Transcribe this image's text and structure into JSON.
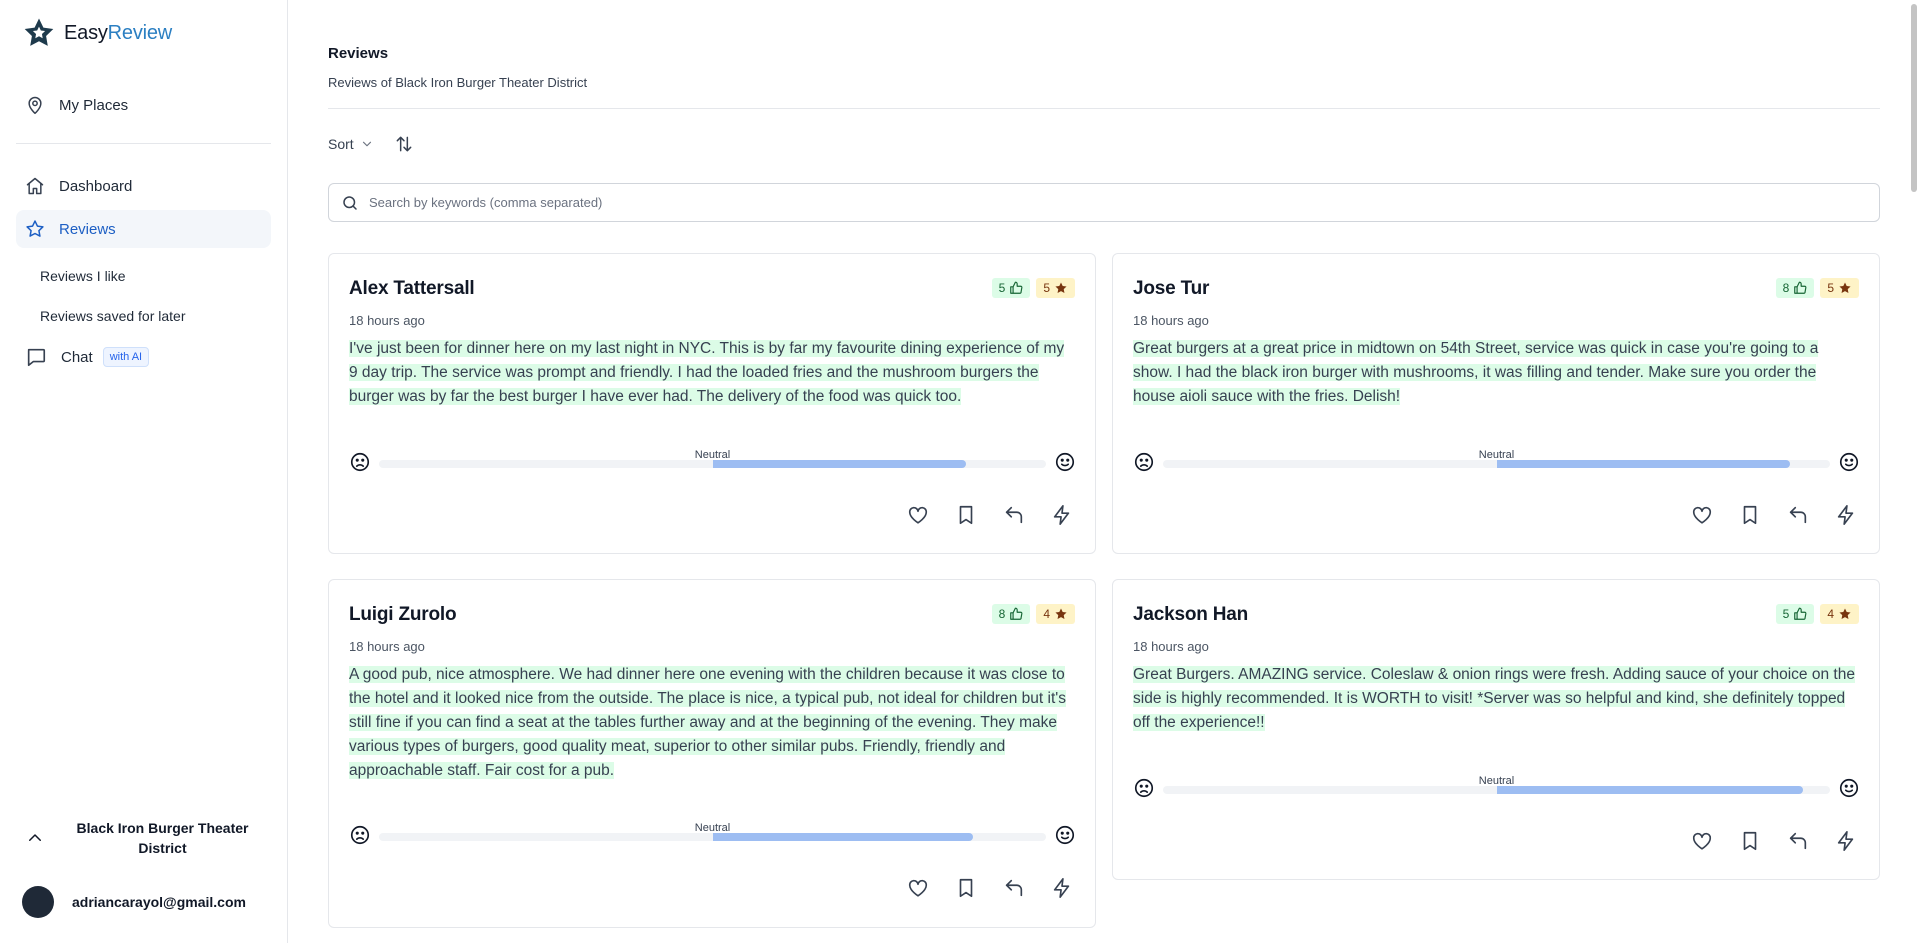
{
  "brand": {
    "part1": "Easy",
    "part2": "Review"
  },
  "sidebar": {
    "my_places": "My Places",
    "dashboard": "Dashboard",
    "reviews": "Reviews",
    "reviews_i_like": "Reviews I like",
    "reviews_saved": "Reviews saved for later",
    "chat": "Chat",
    "chat_badge": "with AI",
    "place_name": "Black Iron Burger Theater District",
    "user_email": "adriancarayol@gmail.com"
  },
  "main": {
    "title": "Reviews",
    "subtitle": "Reviews of Black Iron Burger Theater District",
    "sort_label": "Sort",
    "search_placeholder": "Search by keywords (comma separated)"
  },
  "sentiment_label": "Neutral",
  "colors": {
    "accent": "#1d5fc4",
    "brand_blue": "#2b7fc2",
    "highlight": "#dcfce7",
    "star_badge": "#fef3c7",
    "sentiment_fill": "#9dbdf2"
  },
  "reviews": [
    {
      "author": "Alex Tattersall",
      "time": "18 hours ago",
      "likes": "5",
      "stars": "5",
      "sentiment": 0.38,
      "text": "I've just been for dinner here on my last night in NYC. This is by far my favourite dining experience of my 9 day trip. The service was prompt and friendly. I had the loaded fries and the mushroom burgers the burger was by far the best burger I have ever had. The delivery of the food was quick too."
    },
    {
      "author": "Jose Tur",
      "time": "18 hours ago",
      "likes": "8",
      "stars": "5",
      "sentiment": 0.44,
      "text": "Great burgers at a great price in midtown on 54th Street, service was quick in case you're going to a show. I had the black iron burger with mushrooms, it was filling and tender. Make sure you order the house aioli sauce with the fries. Delish!"
    },
    {
      "author": "Luigi Zurolo",
      "time": "18 hours ago",
      "likes": "8",
      "stars": "4",
      "sentiment": 0.39,
      "text": "A good pub, nice atmosphere. We had dinner here one evening with the children because it was close to the hotel and it looked nice from the outside. The place is nice, a typical pub, not ideal for children but it's still fine if you can find a seat at the tables further away and at the beginning of the evening. They make various types of burgers, good quality meat, superior to other similar pubs. Friendly, friendly and approachable staff. Fair cost for a pub."
    },
    {
      "author": "Jackson Han",
      "time": "18 hours ago",
      "likes": "5",
      "stars": "4",
      "sentiment": 0.46,
      "text": "Great Burgers. AMAZING service. Coleslaw & onion rings were fresh. Adding sauce of your choice on the side is highly recommended. It is WORTH to visit! *Server was so helpful and kind, she definitely topped off the experience!!"
    }
  ]
}
